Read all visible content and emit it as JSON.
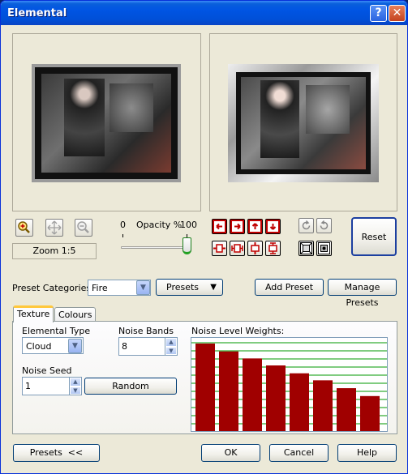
{
  "window": {
    "title": "Elemental",
    "help_glyph": "?",
    "close_glyph": "✕"
  },
  "zoom": {
    "label": "Zoom 1:5"
  },
  "opacity": {
    "min": "0",
    "label": "Opacity %",
    "max": "100",
    "value": 100
  },
  "reset_label": "Reset",
  "presets_row": {
    "categories_label": "Preset Categories:",
    "category_value": "Fire",
    "presets_menu_label": "Presets",
    "add_label": "Add Preset",
    "manage_label": "Manage Presets"
  },
  "tabs": [
    {
      "label": "Texture"
    },
    {
      "label": "Colours"
    }
  ],
  "texture": {
    "elemental_type_label": "Elemental Type",
    "elemental_type_value": "Cloud",
    "noise_bands_label": "Noise Bands",
    "noise_bands_value": "8",
    "noise_seed_label": "Noise Seed",
    "noise_seed_value": "1",
    "random_label": "Random",
    "weights_label": "Noise Level Weights:",
    "weights": [
      1.0,
      0.91,
      0.83,
      0.75,
      0.66,
      0.58,
      0.49,
      0.4
    ],
    "bar_color": "#a00000",
    "grid_color": "#009900"
  },
  "footer": {
    "presets_toggle": "Presets  <<",
    "ok": "OK",
    "cancel": "Cancel",
    "help": "Help"
  }
}
